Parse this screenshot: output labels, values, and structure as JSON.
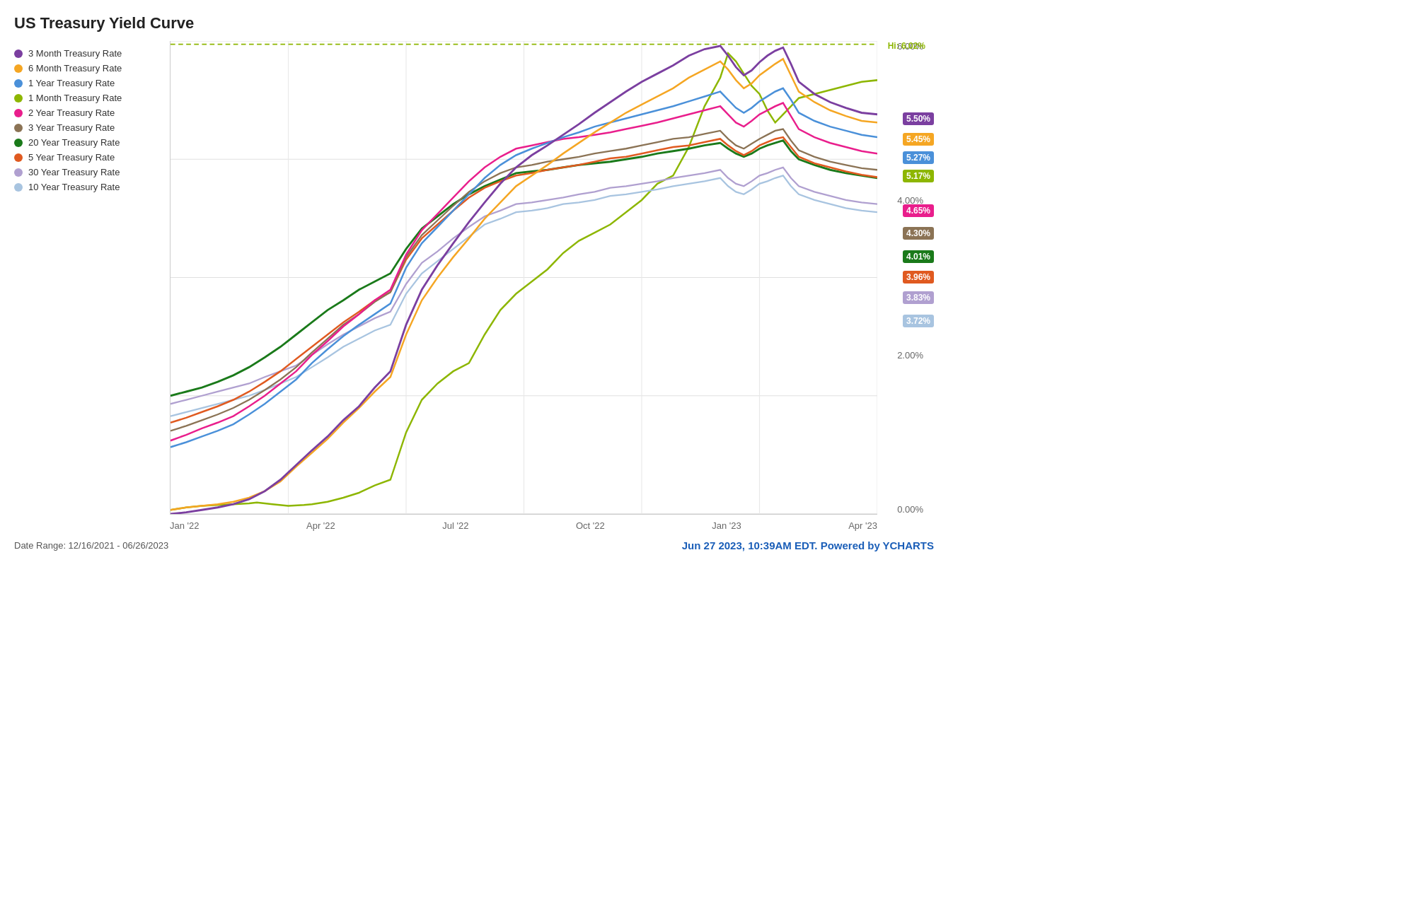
{
  "title": "US Treasury Yield Curve",
  "legend": [
    {
      "label": "3 Month Treasury Rate",
      "color": "#7B3FA0"
    },
    {
      "label": "6 Month Treasury Rate",
      "color": "#F5A623"
    },
    {
      "label": "1 Year Treasury Rate",
      "color": "#4A90D9"
    },
    {
      "label": "1 Month Treasury Rate",
      "color": "#8DB600"
    },
    {
      "label": "2 Year Treasury Rate",
      "color": "#E91E8C"
    },
    {
      "label": "3 Year Treasury Rate",
      "color": "#8B7355"
    },
    {
      "label": "20 Year Treasury Rate",
      "color": "#1A7A1A"
    },
    {
      "label": "5 Year Treasury Rate",
      "color": "#E05A20"
    },
    {
      "label": "30 Year Treasury Rate",
      "color": "#B0A0D0"
    },
    {
      "label": "10 Year Treasury Rate",
      "color": "#A8C4E0"
    }
  ],
  "yAxis": [
    "6.00%",
    "4.00%",
    "2.00%",
    "0.00%"
  ],
  "xAxis": [
    "Jan '22",
    "Apr '22",
    "Jul '22",
    "Oct '22",
    "Jan '23",
    "Apr '23"
  ],
  "badges": [
    {
      "value": "5.50%",
      "color": "#7B3FA0",
      "top": "18%"
    },
    {
      "value": "5.45%",
      "color": "#F5A623",
      "top": "22%"
    },
    {
      "value": "5.27%",
      "color": "#4A90D9",
      "top": "26%"
    },
    {
      "value": "5.17%",
      "color": "#8DB600",
      "top": "30%"
    },
    {
      "value": "4.65%",
      "color": "#E91E8C",
      "top": "38%"
    },
    {
      "value": "4.30%",
      "color": "#8B7355",
      "top": "44%"
    },
    {
      "value": "4.01%",
      "color": "#1A7A1A",
      "top": "50%"
    },
    {
      "value": "3.96%",
      "color": "#E05A20",
      "top": "54%"
    },
    {
      "value": "3.83%",
      "color": "#B0A0D0",
      "top": "58%"
    },
    {
      "value": "3.72%",
      "color": "#A8C4E0",
      "top": "62%"
    }
  ],
  "hiLabel": "Hi: 6.02%",
  "dateRange": "Date Range: 12/16/2021 - 06/26/2023",
  "footer": "Jun 27 2023, 10:39AM EDT. Powered by",
  "footerBrand": "YCHARTS"
}
